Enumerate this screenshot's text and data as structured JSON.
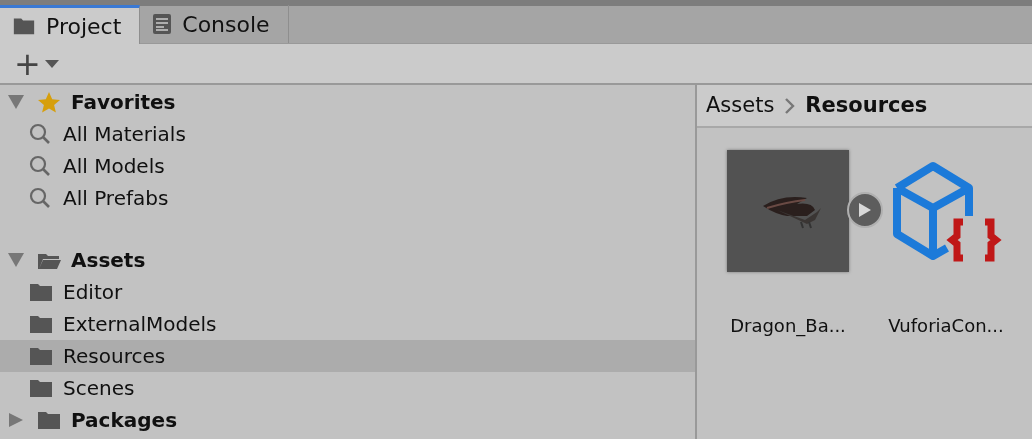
{
  "tabs": [
    {
      "label": "Project",
      "kind": "folder",
      "selected": true
    },
    {
      "label": "Console",
      "kind": "console",
      "selected": false
    }
  ],
  "toolbar": {
    "add_button": "+"
  },
  "tree": [
    {
      "label": "Favorites",
      "kind": "star",
      "expanded": true,
      "selected": false,
      "children": [
        {
          "label": "All Materials",
          "kind": "search",
          "selected": false
        },
        {
          "label": "All Models",
          "kind": "search",
          "selected": false
        },
        {
          "label": "All Prefabs",
          "kind": "search",
          "selected": false
        }
      ]
    },
    {
      "label": "Assets",
      "kind": "folder",
      "expanded": true,
      "selected": false,
      "children": [
        {
          "label": "Editor",
          "kind": "folder",
          "selected": false
        },
        {
          "label": "ExternalModels",
          "kind": "folder",
          "selected": false
        },
        {
          "label": "Resources",
          "kind": "folder",
          "selected": true
        },
        {
          "label": "Scenes",
          "kind": "folder",
          "selected": false
        }
      ]
    },
    {
      "label": "Packages",
      "kind": "folder",
      "expanded": false,
      "selected": false
    }
  ],
  "breadcrumb": [
    "Assets",
    "Resources"
  ],
  "assets": [
    {
      "name": "Dragon_Ba...",
      "kind": "model"
    },
    {
      "name": "VuforiaCon...",
      "kind": "config"
    }
  ]
}
